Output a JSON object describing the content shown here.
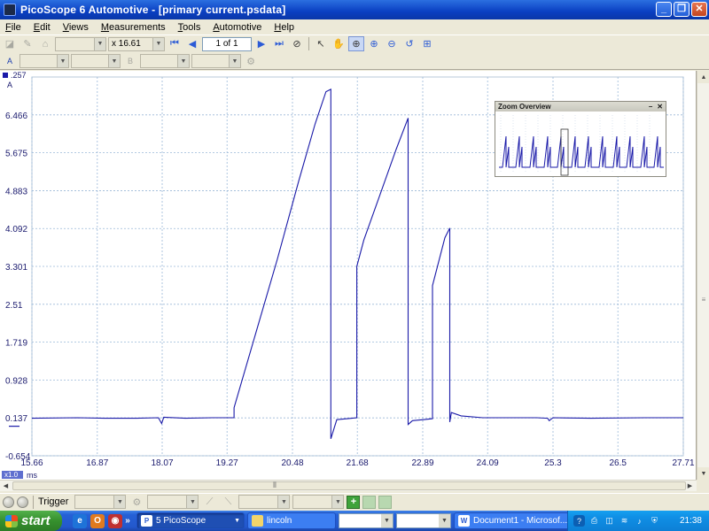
{
  "window": {
    "title": "PicoScope 6 Automotive - [primary current.psdata]",
    "min_label": "_",
    "max_label": "❐",
    "close_label": "✕"
  },
  "menu": [
    "File",
    "Edit",
    "Views",
    "Measurements",
    "Tools",
    "Automotive",
    "Help"
  ],
  "toolbar": {
    "zoom_factor": "x 16.61",
    "page_indicator": "1 of 1"
  },
  "channel_bar": {
    "channel_a_label": "A",
    "channel_b_label": "B"
  },
  "scope": {
    "y_unit": "A",
    "x_unit": "ms",
    "x_zoom_badge": "x1.0",
    "y_top_label": ".257",
    "y_ticks": [
      "6.466",
      "5.675",
      "4.883",
      "4.092",
      "3.301",
      "2.51",
      "1.719",
      "0.928",
      "0.137",
      "-0.654"
    ],
    "x_ticks": [
      "15.66",
      "16.87",
      "18.07",
      "19.27",
      "20.48",
      "21.68",
      "22.89",
      "24.09",
      "25.3",
      "26.5",
      "27.71"
    ],
    "trace_color": "#1a1aa8",
    "grid_color": "#9ab8d8"
  },
  "chart_data": {
    "type": "line",
    "title": "",
    "xlabel": "ms",
    "ylabel": "A",
    "xlim": [
      15.66,
      27.71
    ],
    "ylim": [
      -0.654,
      7.257
    ],
    "grid": true,
    "series": [
      {
        "x": [
          15.66,
          16.5,
          17.0,
          17.6,
          18.0,
          18.06,
          18.1,
          18.5,
          19.0,
          19.4,
          19.4,
          19.8,
          20.2,
          20.6,
          20.9,
          21.1,
          21.19,
          21.19,
          21.3,
          21.5,
          21.67,
          21.67,
          21.8,
          22.1,
          22.4,
          22.62,
          22.62,
          22.7,
          22.9,
          23.07,
          23.07,
          23.3,
          23.39,
          23.39,
          23.42,
          23.6,
          24.0,
          25.0,
          25.2,
          25.23,
          25.3,
          26.0,
          27.0,
          27.71
        ],
        "y": [
          0.13,
          0.14,
          0.13,
          0.13,
          0.14,
          0.02,
          0.15,
          0.13,
          0.14,
          0.14,
          0.35,
          1.9,
          3.45,
          5.1,
          6.28,
          6.95,
          7.0,
          -0.3,
          0.1,
          0.12,
          0.14,
          3.3,
          3.85,
          4.8,
          5.75,
          6.4,
          0.0,
          0.08,
          0.1,
          0.12,
          2.9,
          3.9,
          4.1,
          0.05,
          0.25,
          0.18,
          0.14,
          0.14,
          0.13,
          0.08,
          0.14,
          0.13,
          0.14,
          0.14
        ]
      }
    ]
  },
  "zoom_overview": {
    "title": "Zoom Overview",
    "close_label": "✕",
    "pin_label": "–"
  },
  "bottom_toolbar": {
    "trigger_label": "Trigger"
  },
  "taskbar": {
    "start_label": "start",
    "tasks": [
      {
        "label": "5 PicoScope",
        "icon": "P"
      },
      {
        "label": "lincoln",
        "icon": "📁"
      },
      {
        "label": "Document1 - Microsof...",
        "icon": "W"
      }
    ],
    "clock": "21:38"
  }
}
